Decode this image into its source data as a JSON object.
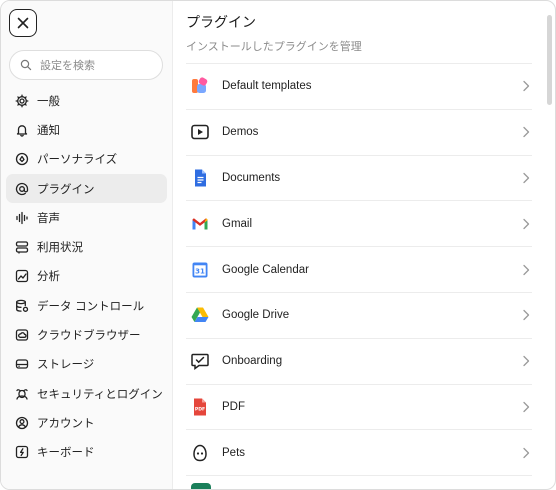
{
  "close_label": "×",
  "search": {
    "placeholder": "設定を検索",
    "value": ""
  },
  "sidebar": {
    "active_index": 3,
    "items": [
      {
        "label": "一般",
        "icon": "gear-icon"
      },
      {
        "label": "通知",
        "icon": "bell-icon"
      },
      {
        "label": "パーソナライズ",
        "icon": "personalize-icon"
      },
      {
        "label": "プラグイン",
        "icon": "at-icon"
      },
      {
        "label": "音声",
        "icon": "voice-icon"
      },
      {
        "label": "利用状況",
        "icon": "usage-icon"
      },
      {
        "label": "分析",
        "icon": "chart-icon"
      },
      {
        "label": "データ コントロール",
        "icon": "database-icon"
      },
      {
        "label": "クラウドブラウザー",
        "icon": "cloud-browser-icon"
      },
      {
        "label": "ストレージ",
        "icon": "storage-icon"
      },
      {
        "label": "セキュリティとログイン",
        "icon": "security-icon"
      },
      {
        "label": "アカウント",
        "icon": "account-icon"
      },
      {
        "label": "キーボード",
        "icon": "keyboard-icon"
      }
    ]
  },
  "main": {
    "title": "プラグイン",
    "subtitle": "インストールしたプラグインを管理",
    "plugins": [
      {
        "name": "Default templates",
        "icon": "templates-icon",
        "color": "#ff7a3d"
      },
      {
        "name": "Demos",
        "icon": "play-icon",
        "color": "#222222"
      },
      {
        "name": "Documents",
        "icon": "google-docs-icon",
        "color": "#2f6de1"
      },
      {
        "name": "Gmail",
        "icon": "gmail-icon",
        "color": "#d93025"
      },
      {
        "name": "Google Calendar",
        "icon": "google-calendar-icon",
        "color": "#4285f4"
      },
      {
        "name": "Google Drive",
        "icon": "google-drive-icon",
        "color": "#34a853"
      },
      {
        "name": "Onboarding",
        "icon": "onboarding-icon",
        "color": "#222222"
      },
      {
        "name": "PDF",
        "icon": "pdf-icon",
        "color": "#e5463b"
      },
      {
        "name": "Pets",
        "icon": "pets-icon",
        "color": "#222222"
      }
    ]
  }
}
